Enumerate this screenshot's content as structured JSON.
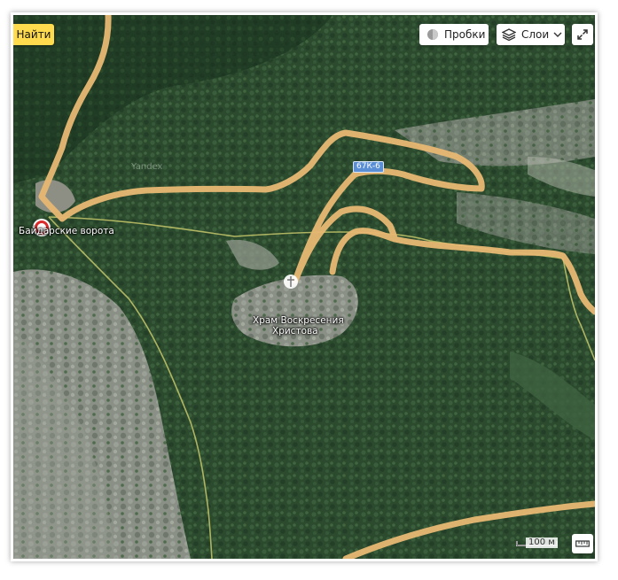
{
  "toolbar": {
    "find_label": "Найти",
    "traffic_label": "Пробки",
    "layers_label": "Слои"
  },
  "map": {
    "watermark": "Yandex",
    "road_shield": "67К-6",
    "places": [
      {
        "label": "Байдарские ворота"
      },
      {
        "label": "Храм Воскресения Христова"
      }
    ],
    "church_label_line1": "Храм Воскресения",
    "church_label_line2": "Христова",
    "scale_label": "100 м"
  },
  "colors": {
    "road": "#e8b873",
    "forest": "#2f4f31",
    "rock": "#8e9488",
    "path": "#c6c86b",
    "find_button": "#ffdb4d",
    "marker": "#d92b2b"
  },
  "icons": [
    "traffic-icon",
    "layers-icon",
    "chevron-down-icon",
    "expand-icon",
    "ruler-icon",
    "church-icon",
    "place-marker-icon"
  ]
}
